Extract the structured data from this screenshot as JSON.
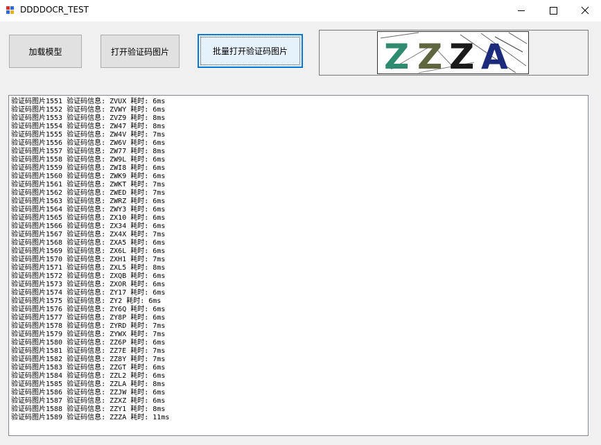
{
  "window": {
    "title": "DDDDOCR_TEST",
    "icon": "app-window-icon"
  },
  "buttons": {
    "load_model": "加载模型",
    "open_captcha": "打开验证码图片",
    "batch_open_captcha": "批量打开验证码图片"
  },
  "captcha_image": {
    "text": "ZZZA",
    "char_colors": [
      "#2e8b70",
      "#5e6640",
      "#1a1a1a",
      "#1b2a7a"
    ]
  },
  "log": {
    "lines": [
      "验证码图片1551 验证码信息: ZVUX 耗时: 6ms",
      "验证码图片1552 验证码信息: ZVWY 耗时: 6ms",
      "验证码图片1553 验证码信息: ZVZ9 耗时: 8ms",
      "验证码图片1554 验证码信息: ZW47 耗时: 8ms",
      "验证码图片1555 验证码信息: ZW4V 耗时: 7ms",
      "验证码图片1556 验证码信息: ZW6V 耗时: 6ms",
      "验证码图片1557 验证码信息: ZW77 耗时: 8ms",
      "验证码图片1558 验证码信息: ZW9L 耗时: 6ms",
      "验证码图片1559 验证码信息: ZWI8 耗时: 6ms",
      "验证码图片1560 验证码信息: ZWK9 耗时: 6ms",
      "验证码图片1561 验证码信息: ZWKT 耗时: 7ms",
      "验证码图片1562 验证码信息: ZWED 耗时: 7ms",
      "验证码图片1563 验证码信息: ZWRZ 耗时: 6ms",
      "验证码图片1564 验证码信息: ZWY3 耗时: 6ms",
      "验证码图片1565 验证码信息: ZX10 耗时: 6ms",
      "验证码图片1566 验证码信息: ZX34 耗时: 6ms",
      "验证码图片1567 验证码信息: ZX4X 耗时: 7ms",
      "验证码图片1568 验证码信息: ZXA5 耗时: 6ms",
      "验证码图片1569 验证码信息: ZX6L 耗时: 6ms",
      "验证码图片1570 验证码信息: ZXH1 耗时: 7ms",
      "验证码图片1571 验证码信息: ZXL5 耗时: 8ms",
      "验证码图片1572 验证码信息: ZXQB 耗时: 6ms",
      "验证码图片1573 验证码信息: ZXOR 耗时: 6ms",
      "验证码图片1574 验证码信息: ZY17 耗时: 6ms",
      "验证码图片1575 验证码信息: ZY2 耗时: 6ms",
      "验证码图片1576 验证码信息: ZY6Q 耗时: 6ms",
      "验证码图片1577 验证码信息: ZY8P 耗时: 6ms",
      "验证码图片1578 验证码信息: ZYRD 耗时: 7ms",
      "验证码图片1579 验证码信息: ZYWX 耗时: 7ms",
      "验证码图片1580 验证码信息: ZZ6P 耗时: 6ms",
      "验证码图片1581 验证码信息: ZZ7E 耗时: 7ms",
      "验证码图片1582 验证码信息: ZZ8Y 耗时: 7ms",
      "验证码图片1583 验证码信息: ZZGT 耗时: 6ms",
      "验证码图片1584 验证码信息: ZZL2 耗时: 6ms",
      "验证码图片1585 验证码信息: ZZLA 耗时: 8ms",
      "验证码图片1586 验证码信息: ZZJW 耗时: 6ms",
      "验证码图片1587 验证码信息: ZZXZ 耗时: 6ms",
      "验证码图片1588 验证码信息: ZZY1 耗时: 8ms",
      "验证码图片1589 验证码信息: ZZZA 耗时: 11ms"
    ]
  }
}
